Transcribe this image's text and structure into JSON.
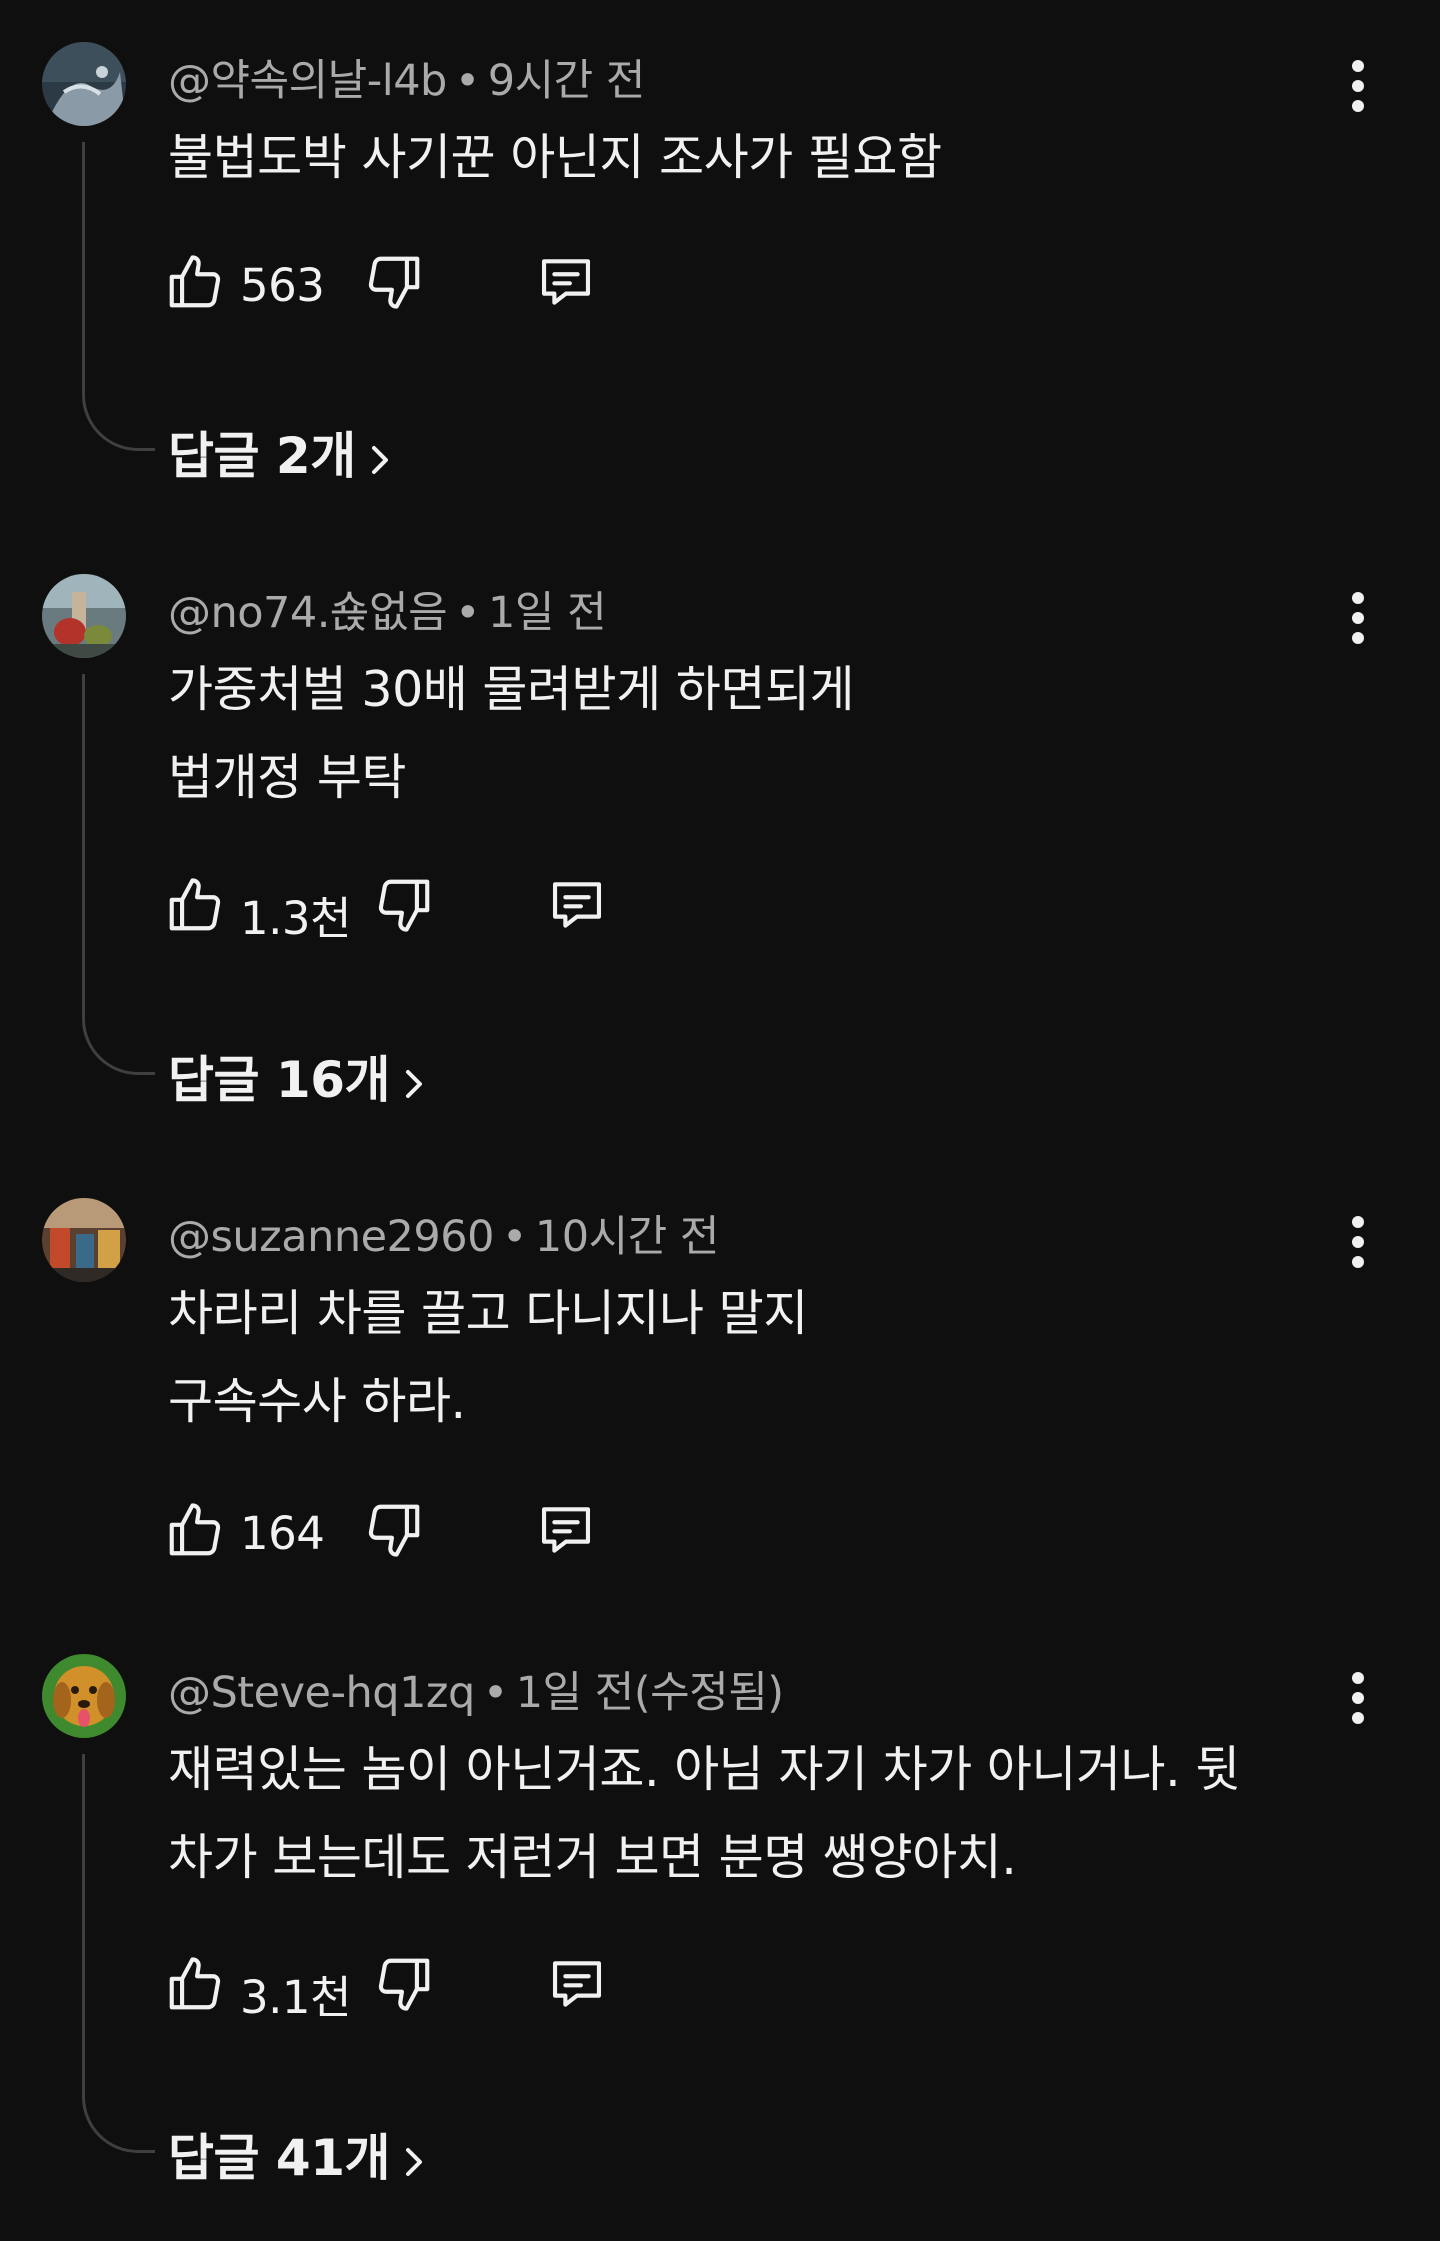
{
  "comments": [
    {
      "username": "@약속의날-l4b",
      "time": "9시간 전",
      "lines": [
        "불법도박 사기꾼 아닌지 조사가 필요함"
      ],
      "likes": "563",
      "replies": "답글 2개"
    },
    {
      "username": "@no74.숁없음",
      "time": "1일 전",
      "lines": [
        "가중처벌 30배 물려받게 하면되게",
        "법개정 부탁"
      ],
      "likes": "1.3천",
      "replies": "답글 16개"
    },
    {
      "username": "@suzanne2960",
      "time": "10시간 전",
      "lines": [
        "차라리 차를 끌고 다니지나 말지",
        "구속수사 하라."
      ],
      "likes": "164",
      "replies": ""
    },
    {
      "username": "@Steve-hq1zq",
      "time": "1일 전(수정됨)",
      "lines": [
        "재력있는 놈이 아닌거죠.  아님 자기 차가 아니거나. 뒷",
        "차가 보는데도 저런거 보면 분명 쌩양아치."
      ],
      "likes": "3.1천",
      "replies": "답글 41개"
    }
  ],
  "meta_separator": "•",
  "icons": {
    "like": "thumbs-up-icon",
    "dislike": "thumbs-down-icon",
    "reply": "reply-comment-icon",
    "more": "more-vertical-icon",
    "chevron": "chevron-right-icon"
  },
  "colors": {
    "background": "#0f0f0f",
    "primary_text": "#f1f1f1",
    "secondary_text": "#aaaaaa",
    "thread_line": "#3f3f3f"
  }
}
